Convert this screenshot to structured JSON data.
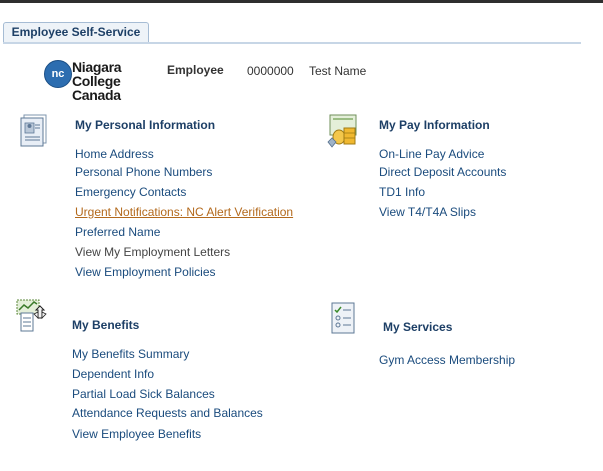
{
  "header": {
    "tab_label": "Employee Self-Service"
  },
  "logo": {
    "badge": "nc",
    "lines": [
      "Niagara",
      "College",
      "Canada"
    ]
  },
  "employee": {
    "label": "Employee",
    "id": "0000000",
    "name": "Test Name"
  },
  "sections": {
    "personal": {
      "title": "My Personal Information",
      "icon": "personal-info-icon",
      "links": [
        "Home Address",
        "Personal Phone Numbers",
        "Emergency Contacts",
        "Urgent Notifications: NC Alert Verification",
        "Preferred Name",
        "View My Employment Letters",
        "View Employment Policies"
      ]
    },
    "pay": {
      "title": "My Pay Information",
      "icon": "pay-info-icon",
      "links": [
        "On-Line Pay Advice",
        "Direct Deposit Accounts",
        "TD1 Info",
        "View T4/T4A Slips"
      ]
    },
    "benefits": {
      "title": "My Benefits",
      "icon": "benefits-icon",
      "links": [
        "My Benefits Summary",
        "Dependent Info",
        "Partial Load Sick Balances",
        "Attendance Requests and Balances",
        "View Employee Benefits"
      ]
    },
    "services": {
      "title": "My Services",
      "icon": "services-checklist-icon",
      "links": [
        "Gym Access Membership"
      ]
    }
  },
  "colors": {
    "link": "#1a4b7d",
    "visited_link": "#b3691c",
    "section_title": "#1d3f66",
    "tab_bg": "#eef3f8"
  }
}
